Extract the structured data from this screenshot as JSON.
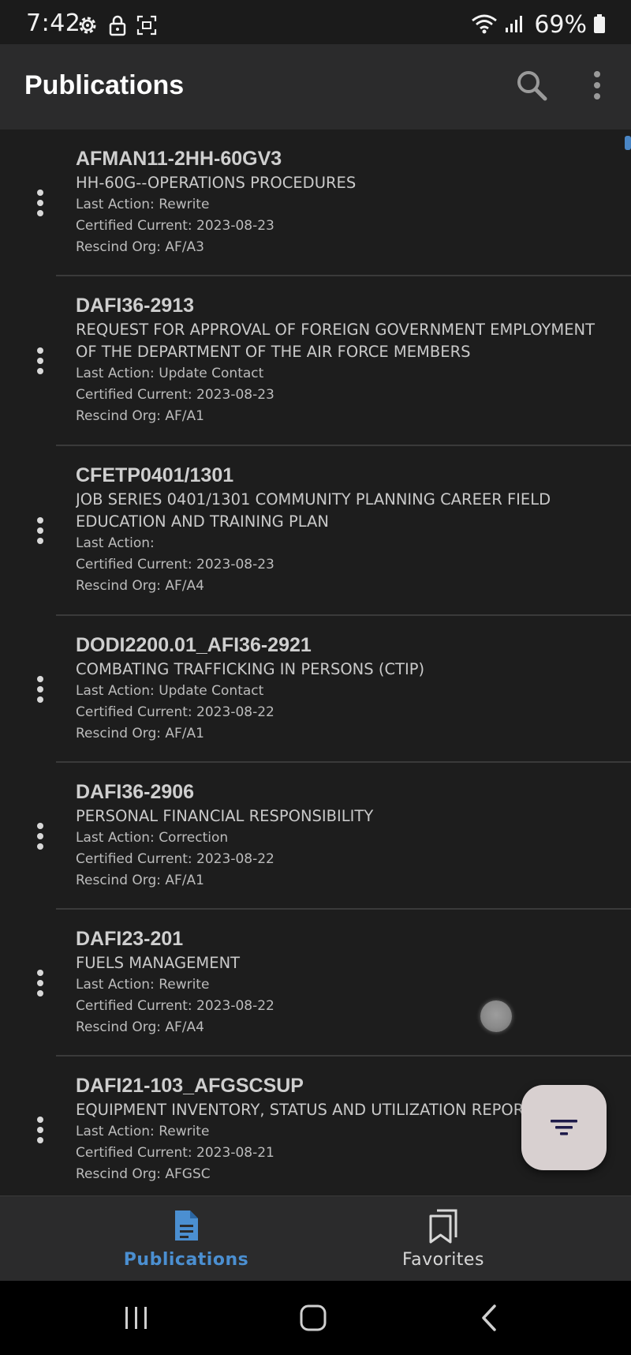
{
  "status_bar": {
    "time": "7:42",
    "battery_percent": "69%",
    "left_icons": [
      "settings-gear-icon",
      "lock-icon",
      "screenshot-icon"
    ],
    "right_icons": [
      "wifi-icon",
      "signal-icon",
      "battery-icon"
    ]
  },
  "app_bar": {
    "title": "Publications",
    "actions": [
      "search-icon",
      "more-vert-icon"
    ]
  },
  "publications": [
    {
      "number": "AFMAN11-2HH-60GV3",
      "title": "HH-60G--OPERATIONS PROCEDURES",
      "last_action": "Last Action: Rewrite",
      "certified": "Certified Current: 2023-08-23",
      "rescind_org": "Rescind Org: AF/A3"
    },
    {
      "number": "DAFI36-2913",
      "title": "REQUEST FOR APPROVAL OF FOREIGN GOVERNMENT EMPLOYMENT OF THE DEPARTMENT OF THE AIR FORCE MEMBERS",
      "last_action": "Last Action: Update Contact",
      "certified": "Certified Current: 2023-08-23",
      "rescind_org": "Rescind Org: AF/A1"
    },
    {
      "number": "CFETP0401/1301",
      "title": "JOB SERIES 0401/1301 COMMUNITY PLANNING CAREER FIELD EDUCATION AND TRAINING PLAN",
      "last_action": "Last Action:",
      "certified": "Certified Current: 2023-08-23",
      "rescind_org": "Rescind Org: AF/A4"
    },
    {
      "number": "DODI2200.01_AFI36-2921",
      "title": "COMBATING TRAFFICKING IN PERSONS (CTIP)",
      "last_action": "Last Action: Update Contact",
      "certified": "Certified Current: 2023-08-22",
      "rescind_org": "Rescind Org: AF/A1"
    },
    {
      "number": "DAFI36-2906",
      "title": "PERSONAL FINANCIAL RESPONSIBILITY",
      "last_action": "Last Action: Correction",
      "certified": "Certified Current: 2023-08-22",
      "rescind_org": "Rescind Org: AF/A1"
    },
    {
      "number": "DAFI23-201",
      "title": "FUELS MANAGEMENT",
      "last_action": "Last Action: Rewrite",
      "certified": "Certified Current: 2023-08-22",
      "rescind_org": "Rescind Org: AF/A4"
    },
    {
      "number": "DAFI21-103_AFGSCSUP",
      "title": "EQUIPMENT INVENTORY, STATUS AND UTILIZATION REPORTING",
      "last_action": "Last Action: Rewrite",
      "certified": "Certified Current: 2023-08-21",
      "rescind_org": "Rescind Org: AFGSC"
    }
  ],
  "fab": {
    "icon": "filter-icon"
  },
  "bottom_nav": {
    "publications_label": "Publications",
    "favorites_label": "Favorites",
    "active": "publications"
  },
  "colors": {
    "background": "#1d1d1d",
    "app_bar": "#2b2b2c",
    "accent": "#4b8fd1",
    "fab": "#d8d0d0",
    "fab_icon": "#1e1b4a"
  }
}
